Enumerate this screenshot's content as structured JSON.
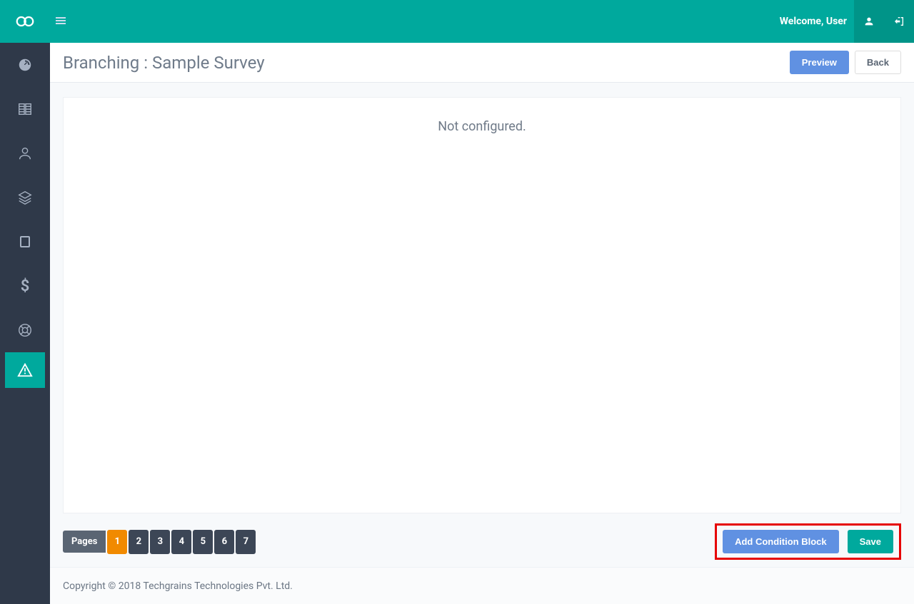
{
  "topbar": {
    "welcome": "Welcome, User"
  },
  "page": {
    "title": "Branching : Sample Survey",
    "preview": "Preview",
    "back": "Back",
    "empty": "Not configured."
  },
  "pagination": {
    "label": "Pages",
    "pages": [
      "1",
      "2",
      "3",
      "4",
      "5",
      "6",
      "7"
    ],
    "active": 0
  },
  "actions": {
    "add": "Add Condition Block",
    "save": "Save"
  },
  "footer": {
    "copyright": "Copyright © 2018 Techgrains Technologies Pvt. Ltd."
  }
}
